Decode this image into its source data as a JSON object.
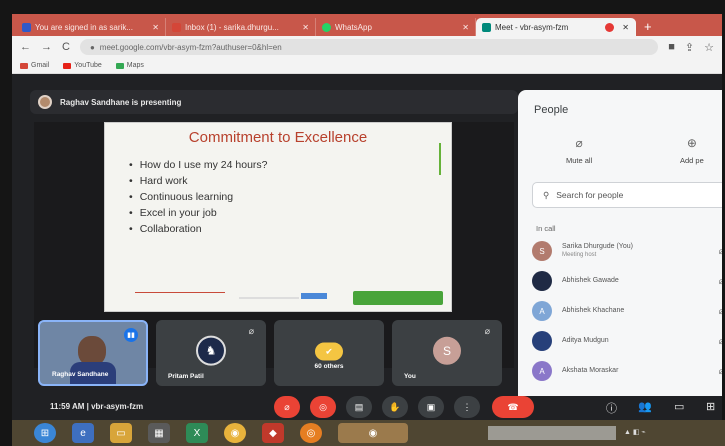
{
  "browser": {
    "tabs": [
      {
        "label": "You are signed in as sarik...",
        "icon_color": "#2f59c8"
      },
      {
        "label": "Inbox (1) - sarika.dhurgu...",
        "icon_color": "#d44638"
      },
      {
        "label": "WhatsApp",
        "icon_color": "#25d366"
      },
      {
        "label": "Meet - vbr-asym-fzm",
        "icon_color": "#00897b"
      }
    ],
    "url": "meet.google.com/vbr-asym-fzm?authuser=0&hl=en",
    "bookmarks": [
      "Gmail",
      "YouTube",
      "Maps"
    ]
  },
  "meet": {
    "presenter_text": "Raghav Sandhane is presenting",
    "meeting_time": "11:59 AM",
    "meeting_code": "vbr-asym-fzm"
  },
  "slide": {
    "title": "Commitment to Excellence",
    "bullets": [
      "How do I use my 24 hours?",
      "Hard work",
      "Continuous learning",
      "Excel in your job",
      "Collaboration"
    ]
  },
  "tiles": [
    {
      "name": "Raghav Sandhane"
    },
    {
      "name": "Pritam Patil"
    },
    {
      "name": "60 others"
    },
    {
      "name": "You",
      "initial": "S"
    }
  ],
  "people_panel": {
    "title": "People",
    "mute_all": "Mute all",
    "add_people": "Add pe",
    "search_placeholder": "Search for people",
    "in_call_label": "In call",
    "participants": [
      {
        "name": "Sarika Dhurgude (You)",
        "role": "Meeting host",
        "initial": "S",
        "color": "#b27b6e"
      },
      {
        "name": "Abhishek Gawade",
        "role": "",
        "initial": "",
        "color": "#1f2a44"
      },
      {
        "name": "Abhishek Khachane",
        "role": "",
        "initial": "A",
        "color": "#7fa6d6"
      },
      {
        "name": "Aditya Mudgun",
        "role": "",
        "initial": "",
        "color": "#27407a"
      },
      {
        "name": "Akshata Moraskar",
        "role": "",
        "initial": "A",
        "color": "#8a77c9"
      }
    ]
  },
  "icons": {
    "mic_off": "mic-off-icon",
    "camera_off": "camera-off-icon",
    "hangup": "hangup-icon",
    "colors": {
      "mute_red": "#ea4335",
      "meet_bg": "#202124",
      "tab_strip": "#c8574a"
    }
  }
}
